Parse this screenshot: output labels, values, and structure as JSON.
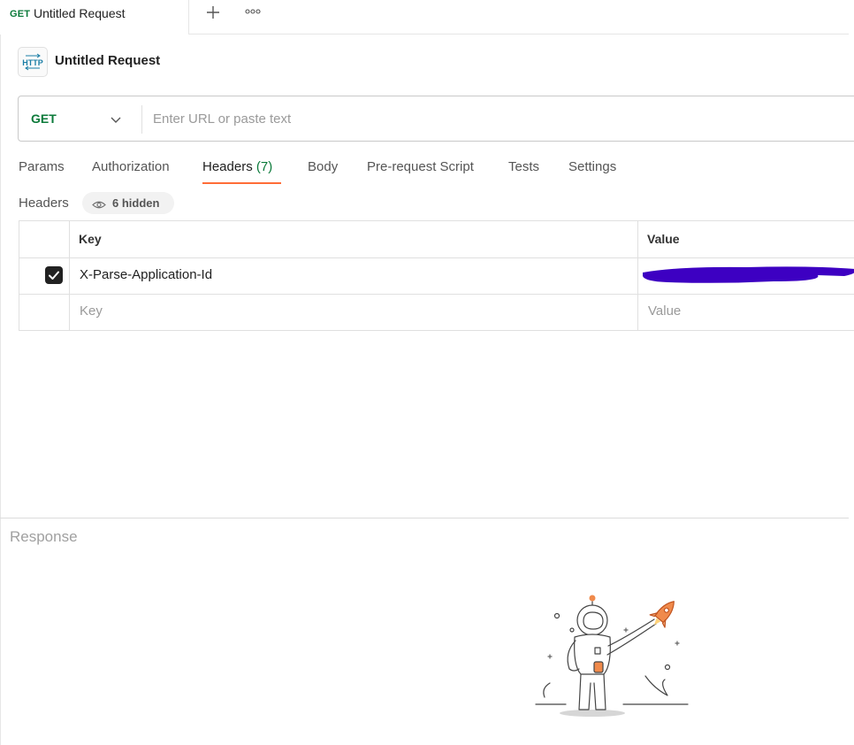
{
  "tabs": {
    "active_tab": {
      "method": "GET",
      "title": "Untitled Request"
    },
    "add_icon": "plus-icon",
    "more_icon": "more-horizontal-icon"
  },
  "request": {
    "badge_text": "HTTP",
    "name": "Untitled Request",
    "method": "GET",
    "url_value": "",
    "url_placeholder": "Enter URL or paste text"
  },
  "request_tabs": [
    {
      "label": "Params"
    },
    {
      "label": "Authorization"
    },
    {
      "label": "Headers",
      "count": "(7)",
      "active": true
    },
    {
      "label": "Body"
    },
    {
      "label": "Pre-request Script"
    },
    {
      "label": "Tests"
    },
    {
      "label": "Settings"
    }
  ],
  "headers_section": {
    "label": "Headers",
    "hidden_label": "6 hidden"
  },
  "headers_table": {
    "columns": [
      "Key",
      "Value"
    ],
    "rows": [
      {
        "enabled": true,
        "key": "X-Parse-Application-Id",
        "value_redacted": true
      }
    ],
    "new_row": {
      "key_placeholder": "Key",
      "value_placeholder": "Value"
    }
  },
  "response": {
    "label": "Response"
  },
  "colors": {
    "method_green": "#0b7a3a",
    "accent_orange": "#ff6c37",
    "redaction_purple": "#3d00c2"
  }
}
